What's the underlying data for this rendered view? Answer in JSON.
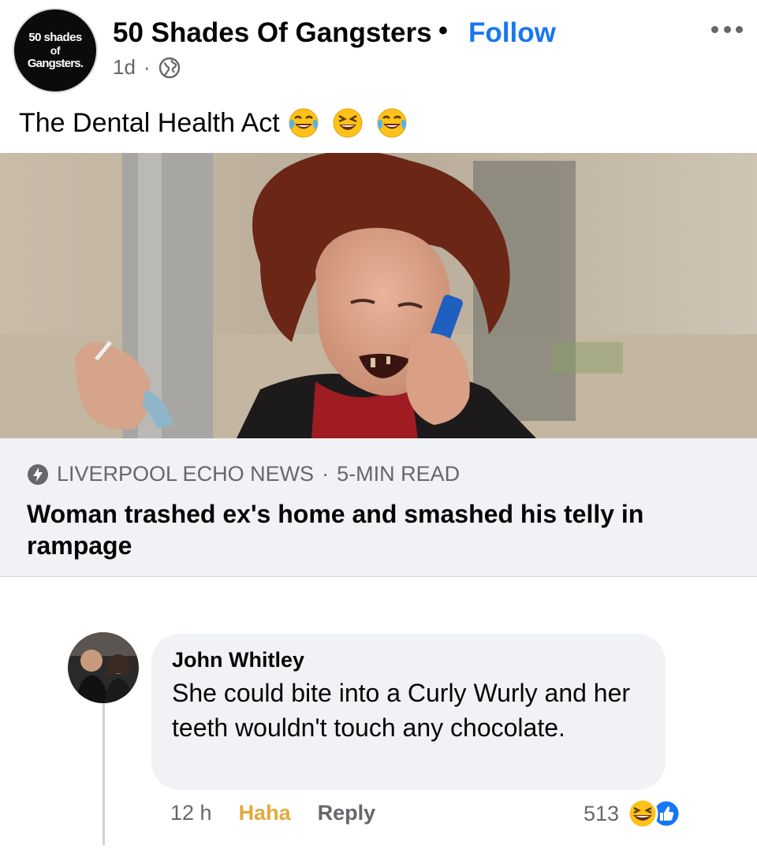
{
  "post": {
    "avatar_lines": [
      "50 shades",
      "of",
      "Gangsters."
    ],
    "page_name": "50 Shades Of Gangsters",
    "separator": "•",
    "follow_label": "Follow",
    "time": "1d",
    "meta_separator": "·",
    "privacy_icon": "globe-icon",
    "more_icon": "more-options-icon",
    "caption": "The Dental Health Act",
    "caption_emojis": [
      "face-with-tears-of-joy",
      "grinning-squinting-face",
      "face-with-tears-of-joy"
    ]
  },
  "link_preview": {
    "source_icon": "instant-article-bolt-icon",
    "source": "LIVERPOOL ECHO NEWS",
    "separator": "·",
    "read_time": "5-MIN READ",
    "title": "Woman trashed ex's home and smashed his telly in rampage"
  },
  "comment": {
    "author": "John Whitley",
    "text": "She could bite into a Curly Wurly and her teeth wouldn't touch any chocolate.",
    "time": "12 h",
    "reaction_label": "Haha",
    "reply_label": "Reply",
    "reaction_count": "513",
    "reaction_icons": [
      "haha-reaction-icon",
      "like-reaction-icon"
    ]
  },
  "colors": {
    "accent": "#1877f2",
    "haha": "#e4a93a",
    "secondary_text": "#65676b",
    "bubble": "#f0f2f5"
  }
}
